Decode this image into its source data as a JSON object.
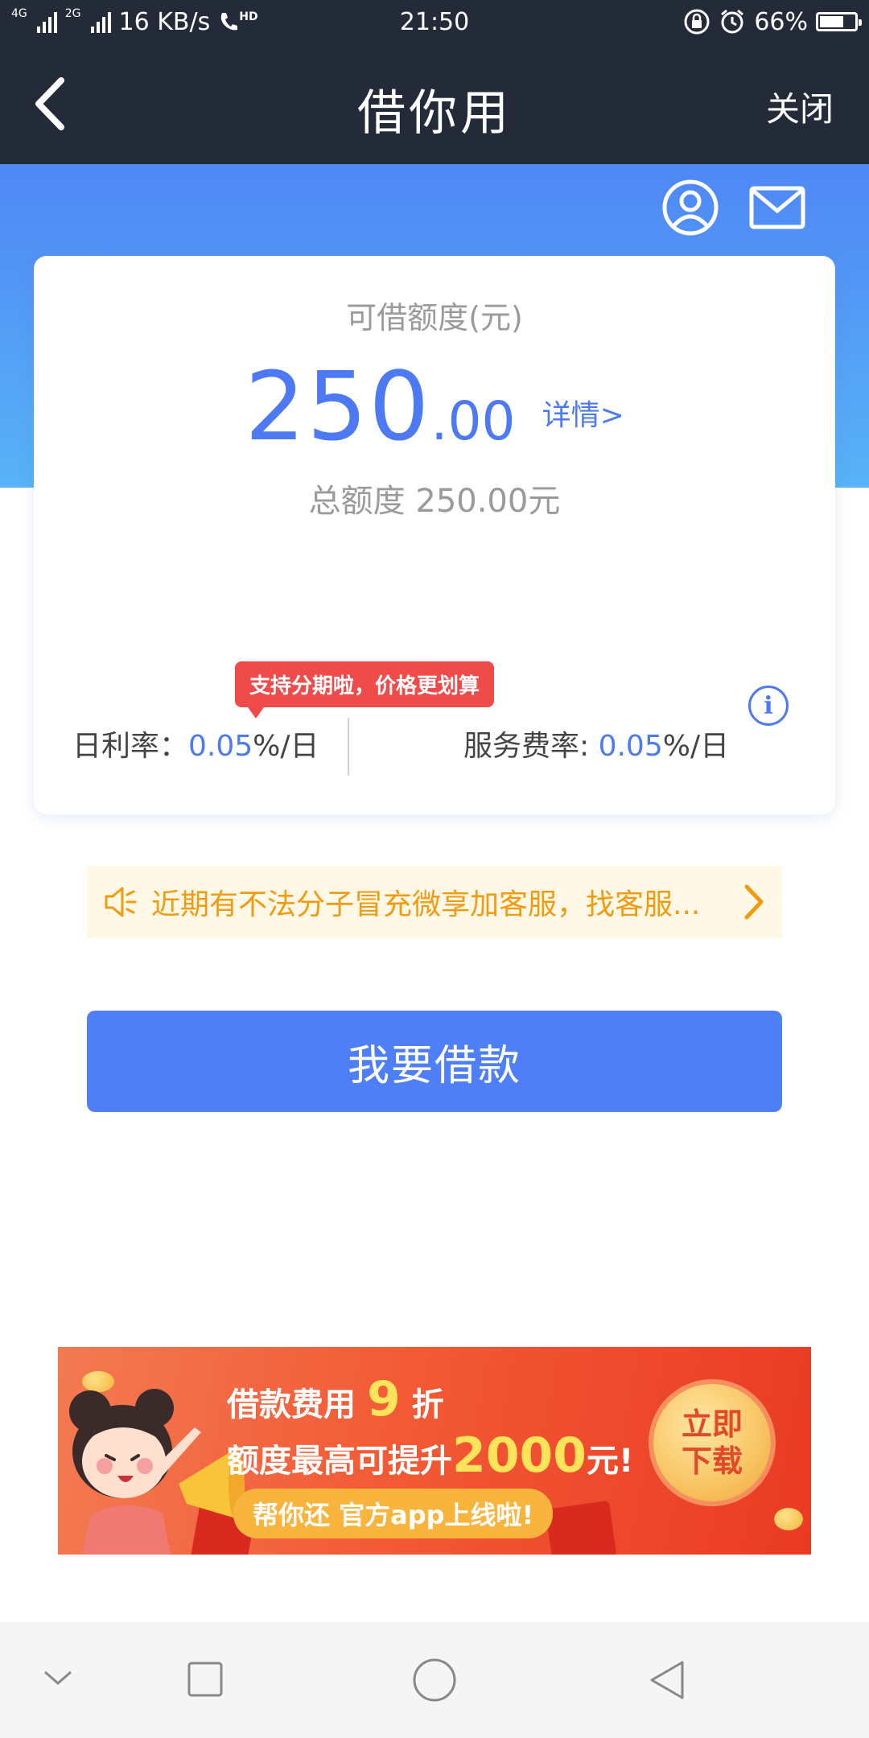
{
  "status_bar": {
    "network_1": "4G",
    "network_2": "2G",
    "speed": "16 KB/s",
    "hd": "HD",
    "time": "21:50",
    "battery": "66%",
    "battery_level": 0.66
  },
  "header": {
    "title": "借你用",
    "close_label": "关闭"
  },
  "card": {
    "label": "可借额度(元)",
    "amount_integer": "250",
    "amount_decimal": ".00",
    "details_link": "详情>",
    "total_line": "总额度 250.00元",
    "promo_tag": "支持分期啦，价格更划算",
    "daily_rate_label": "日利率：",
    "daily_rate_value": "0.05",
    "daily_rate_unit": "%/日",
    "service_rate_label": "服务费率: ",
    "service_rate_value": "0.05",
    "service_rate_unit": "%/日"
  },
  "notice": {
    "text": "近期有不法分子冒充微享加客服，找客服..."
  },
  "borrow_button": {
    "label": "我要借款"
  },
  "banner": {
    "line1_a": "借款费用",
    "line1_num": "9",
    "line1_b": "折",
    "line2_a": "额度最高可提升",
    "line2_num": "2000",
    "line2_b": "元!",
    "pill": "帮你还 官方app上线啦!",
    "cta_line1": "立即",
    "cta_line2": "下载"
  },
  "colors": {
    "header_bg": "#242b38",
    "accent": "#4f7ff6",
    "notice_text": "#f29b11",
    "promo_red": "#ef4b4b"
  }
}
